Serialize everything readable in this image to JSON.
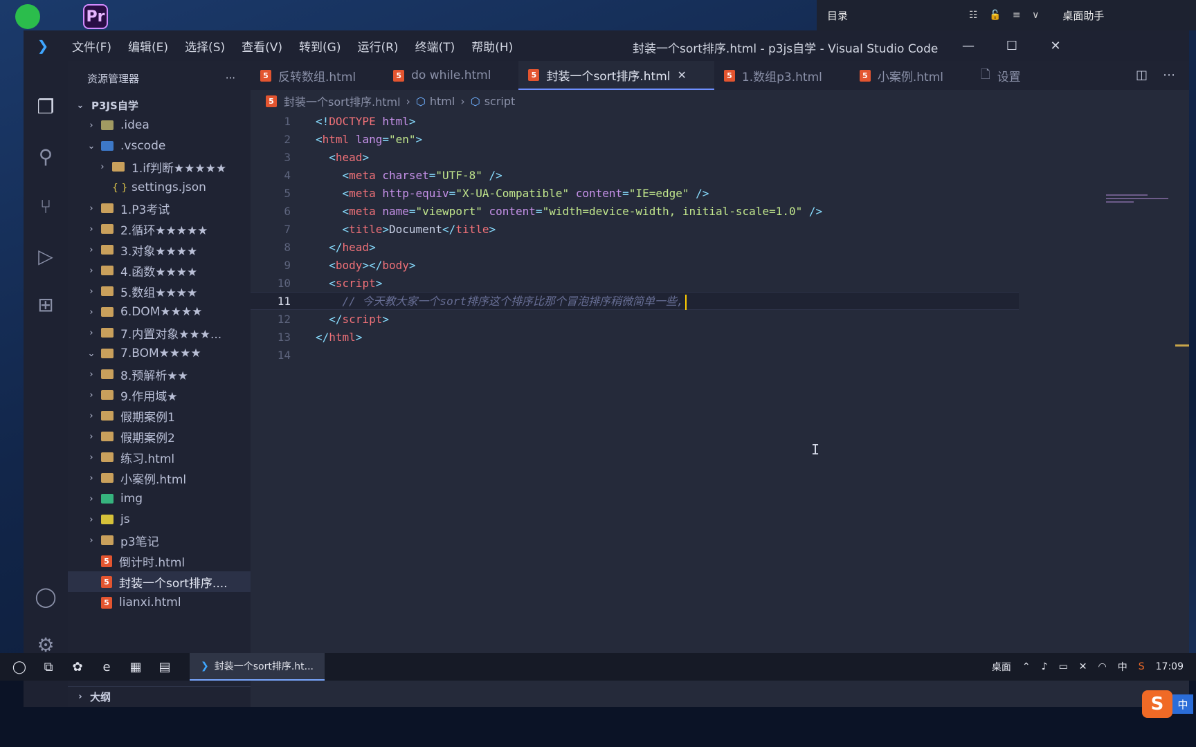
{
  "desktop": {
    "pr_icon": "Pr",
    "top_panel": {
      "mulu": "目录",
      "tools": "☷ 🔓 ≡ ∨",
      "helper": "桌面助手"
    }
  },
  "titlebar": {
    "menus": [
      "文件(F)",
      "编辑(E)",
      "选择(S)",
      "查看(V)",
      "转到(G)",
      "运行(R)",
      "终端(T)",
      "帮助(H)"
    ],
    "window_title": "封装一个sort排序.html - p3js自学 - Visual Studio Code"
  },
  "sidebar": {
    "title": "资源管理器",
    "more": "···",
    "root": "P3JS自学",
    "items": [
      {
        "label": ".idea",
        "chev": "›",
        "indent": 1,
        "icon": "folder-idea"
      },
      {
        "label": ".vscode",
        "chev": "⌄",
        "indent": 1,
        "icon": "folder-vscode"
      },
      {
        "label": "1.if判断★★★★★",
        "chev": "›",
        "indent": 2,
        "icon": "folder"
      },
      {
        "label": "settings.json",
        "chev": "",
        "indent": 2,
        "icon": "file-json"
      },
      {
        "label": "1.P3考试",
        "chev": "›",
        "indent": 1,
        "icon": "folder"
      },
      {
        "label": "2.循环★★★★★",
        "chev": "›",
        "indent": 1,
        "icon": "folder"
      },
      {
        "label": "3.对象★★★★",
        "chev": "›",
        "indent": 1,
        "icon": "folder"
      },
      {
        "label": "4.函数★★★★",
        "chev": "›",
        "indent": 1,
        "icon": "folder"
      },
      {
        "label": "5.数组★★★★",
        "chev": "›",
        "indent": 1,
        "icon": "folder"
      },
      {
        "label": "6.DOM★★★★",
        "chev": "›",
        "indent": 1,
        "icon": "folder"
      },
      {
        "label": "7.内置对象★★★...",
        "chev": "›",
        "indent": 1,
        "icon": "folder"
      },
      {
        "label": "7.BOM★★★★",
        "chev": "⌄",
        "indent": 1,
        "icon": "folder"
      },
      {
        "label": "8.预解析★★",
        "chev": "›",
        "indent": 1,
        "icon": "folder"
      },
      {
        "label": "9.作用域★",
        "chev": "›",
        "indent": 1,
        "icon": "folder"
      },
      {
        "label": "假期案例1",
        "chev": "›",
        "indent": 1,
        "icon": "folder"
      },
      {
        "label": "假期案例2",
        "chev": "›",
        "indent": 1,
        "icon": "folder"
      },
      {
        "label": "练习.html",
        "chev": "›",
        "indent": 1,
        "icon": "folder"
      },
      {
        "label": "小案例.html",
        "chev": "›",
        "indent": 1,
        "icon": "folder"
      },
      {
        "label": "img",
        "chev": "›",
        "indent": 1,
        "icon": "folder-img"
      },
      {
        "label": "js",
        "chev": "›",
        "indent": 1,
        "icon": "folder-js"
      },
      {
        "label": "p3笔记",
        "chev": "›",
        "indent": 1,
        "icon": "folder"
      },
      {
        "label": "倒计时.html",
        "chev": "",
        "indent": 1,
        "icon": "file-html"
      },
      {
        "label": "封装一个sort排序....",
        "chev": "",
        "indent": 1,
        "icon": "file-html",
        "selected": true
      },
      {
        "label": "lianxi.html",
        "chev": "",
        "indent": 1,
        "icon": "file-html"
      }
    ],
    "outline": "大纲"
  },
  "tabs": [
    {
      "label": "反转数组.html",
      "active": false
    },
    {
      "label": "do while.html",
      "active": false
    },
    {
      "label": "封装一个sort排序.html",
      "active": true
    },
    {
      "label": "1.数组p3.html",
      "active": false
    },
    {
      "label": "小案例.html",
      "active": false
    },
    {
      "label": "设置",
      "active": false,
      "settings": true
    }
  ],
  "breadcrumb": {
    "file": "封装一个sort排序.html",
    "node1": "html",
    "node2": "script"
  },
  "code_lines": [
    {
      "n": "1",
      "html": "<span class='punct'>&lt;!</span><span class='tag'>DOCTYPE</span> <span class='attr'>html</span><span class='punct'>&gt;</span>"
    },
    {
      "n": "2",
      "html": "<span class='punct'>&lt;</span><span class='tag'>html</span> <span class='attr'>lang</span><span class='punct'>=</span><span class='str'>\"en\"</span><span class='punct'>&gt;</span>"
    },
    {
      "n": "3",
      "html": "  <span class='punct'>&lt;</span><span class='tag'>head</span><span class='punct'>&gt;</span>"
    },
    {
      "n": "4",
      "html": "    <span class='punct'>&lt;</span><span class='tag'>meta</span> <span class='attr'>charset</span><span class='punct'>=</span><span class='str'>\"UTF-8\"</span> <span class='punct'>/&gt;</span>"
    },
    {
      "n": "5",
      "html": "    <span class='punct'>&lt;</span><span class='tag'>meta</span> <span class='attr'>http-equiv</span><span class='punct'>=</span><span class='str'>\"X-UA-Compatible\"</span> <span class='attr'>content</span><span class='punct'>=</span><span class='str'>\"IE=edge\"</span> <span class='punct'>/&gt;</span>"
    },
    {
      "n": "6",
      "html": "    <span class='punct'>&lt;</span><span class='tag'>meta</span> <span class='attr'>name</span><span class='punct'>=</span><span class='str'>\"viewport\"</span> <span class='attr'>content</span><span class='punct'>=</span><span class='str'>\"width=device-width, initial-scale=1.0\"</span> <span class='punct'>/&gt;</span>"
    },
    {
      "n": "7",
      "html": "    <span class='punct'>&lt;</span><span class='tag'>title</span><span class='punct'>&gt;</span>Document<span class='punct'>&lt;/</span><span class='tag'>title</span><span class='punct'>&gt;</span>"
    },
    {
      "n": "8",
      "html": "  <span class='punct'>&lt;/</span><span class='tag'>head</span><span class='punct'>&gt;</span>"
    },
    {
      "n": "9",
      "html": "  <span class='punct'>&lt;</span><span class='tag'>body</span><span class='punct'>&gt;&lt;/</span><span class='tag'>body</span><span class='punct'>&gt;</span>"
    },
    {
      "n": "10",
      "html": "  <span class='punct'>&lt;</span><span class='tag'>script</span><span class='punct'>&gt;</span>"
    },
    {
      "n": "11",
      "html": "    <span class='comment'>// 今天教大家一个sort排序这个排序比那个冒泡排序稍微简单一些,</span><span class='cursor'></span>",
      "current": true
    },
    {
      "n": "12",
      "html": "  <span class='punct'>&lt;/</span><span class='tag'>script</span><span class='punct'>&gt;</span>"
    },
    {
      "n": "13",
      "html": "<span class='punct'>&lt;/</span><span class='tag'>html</span><span class='punct'>&gt;</span>"
    },
    {
      "n": "14",
      "html": ""
    }
  ],
  "taskbar": {
    "app_label": "封装一个sort排序.ht...",
    "desktop": "桌面",
    "ime": "中",
    "time": "17:09"
  },
  "sogou": {
    "s": "S",
    "cn": "中"
  }
}
